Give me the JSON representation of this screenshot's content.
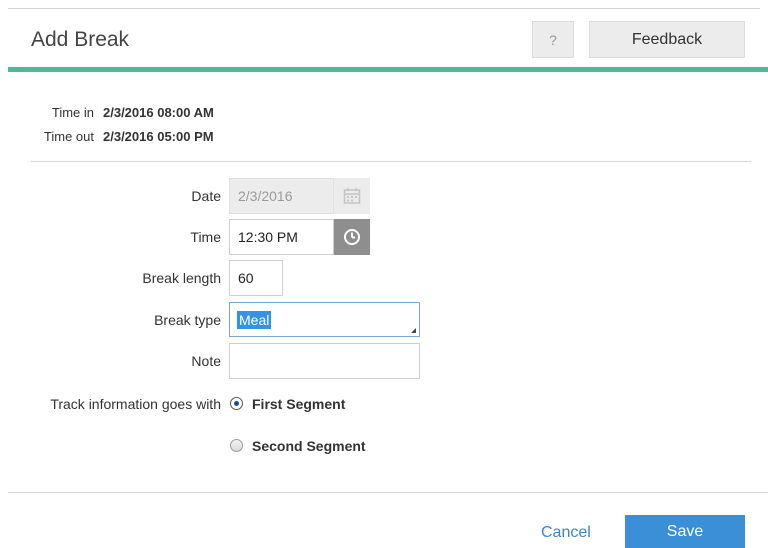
{
  "dialog": {
    "title": "Add Break",
    "help_label": "?",
    "feedback_label": "Feedback",
    "accent_color": "#4fb897"
  },
  "info": {
    "time_in_label": "Time in",
    "time_in_value": "2/3/2016 08:00 AM",
    "time_out_label": "Time out",
    "time_out_value": "2/3/2016 05:00 PM"
  },
  "form": {
    "date_label": "Date",
    "date_value": "2/3/2016",
    "time_label": "Time",
    "time_value": "12:30 PM",
    "break_length_label": "Break length",
    "break_length_value": "60",
    "break_type_label": "Break type",
    "break_type_value": "Meal",
    "note_label": "Note",
    "note_value": "",
    "track_label": "Track information goes with",
    "track_options": [
      {
        "label": "First Segment",
        "checked": true
      },
      {
        "label": "Second Segment",
        "checked": false
      }
    ]
  },
  "footer": {
    "cancel_label": "Cancel",
    "save_label": "Save",
    "save_color": "#3a8fd6"
  },
  "icons": {
    "calendar": "calendar-icon",
    "clock": "clock-icon"
  }
}
